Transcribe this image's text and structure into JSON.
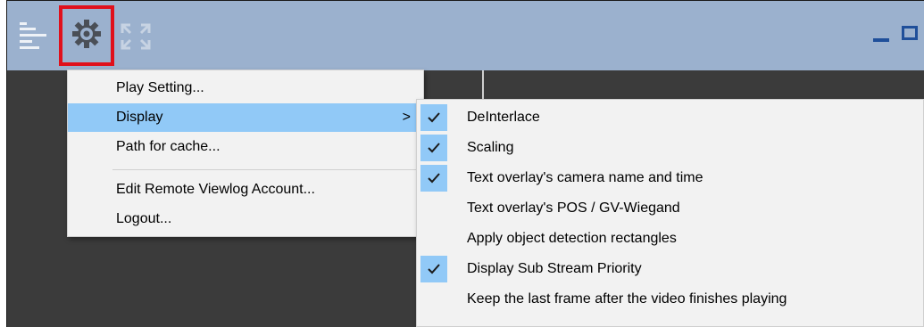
{
  "toolbar": {
    "icons": [
      "hamburger-icon",
      "gear-icon",
      "expand-icon",
      "minimize-icon",
      "maximize-icon"
    ],
    "accent": "#9bb1ce",
    "highlight_border": "#e0101b"
  },
  "main_menu": {
    "items": [
      {
        "label": "Play Setting..."
      },
      {
        "label": "Display",
        "submenu_arrow": ">"
      },
      {
        "label": "Path for cache..."
      },
      {
        "label": "Edit Remote Viewlog Account..."
      },
      {
        "label": "Logout..."
      }
    ],
    "selected_index": 1
  },
  "display_submenu": {
    "items": [
      {
        "label": "DeInterlace",
        "checked": true
      },
      {
        "label": "Scaling",
        "checked": true
      },
      {
        "label": "Text overlay's camera name and time",
        "checked": true
      },
      {
        "label": "Text overlay's POS / GV-Wiegand",
        "checked": false
      },
      {
        "label": "Apply object detection rectangles",
        "checked": false
      },
      {
        "label": "Display Sub Stream Priority",
        "checked": true
      },
      {
        "label": "Keep the last frame after the video finishes playing",
        "checked": false
      }
    ]
  },
  "colors": {
    "menu_highlight": "#91c9f7",
    "menu_bg": "#f2f2f2",
    "window_control": "#1f4f9a"
  }
}
